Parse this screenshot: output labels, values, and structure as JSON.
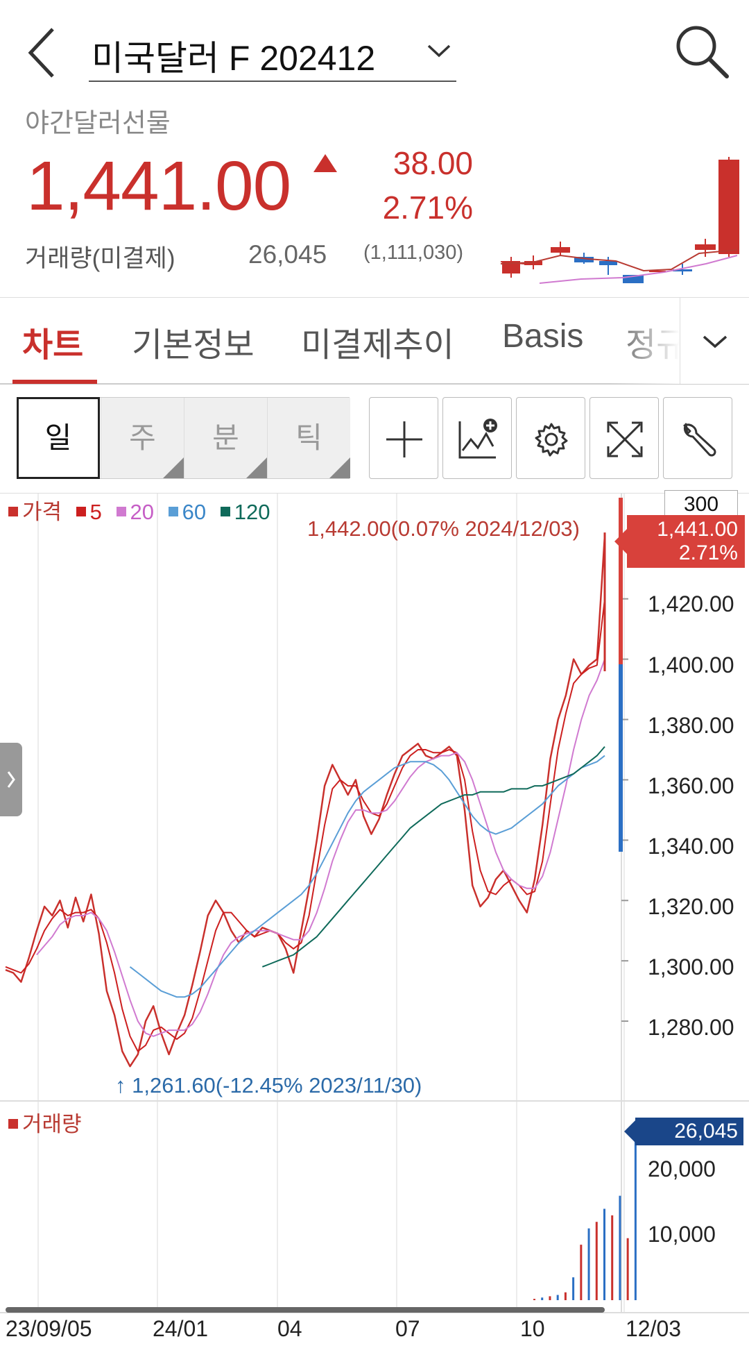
{
  "header": {
    "title": "미국달러 F 202412"
  },
  "quote": {
    "market_name": "야간달러선물",
    "price": "1,441.00",
    "change": "38.00",
    "change_pct": "2.71%",
    "volume_label": "거래량(미결제)",
    "volume": "26,045",
    "open_interest": "(1,111,030)"
  },
  "tabs": [
    {
      "label": "차트",
      "active": true
    },
    {
      "label": "기본정보",
      "active": false
    },
    {
      "label": "미결제추이",
      "active": false
    },
    {
      "label": "Basis",
      "active": false
    },
    {
      "label": "정규",
      "active": false
    }
  ],
  "toolbar": {
    "periods": [
      "일",
      "주",
      "분",
      "틱"
    ],
    "active_period": "일",
    "tools": [
      "crosshair-icon",
      "add-indicator-icon",
      "gear-icon",
      "expand-icon",
      "wrench-icon"
    ]
  },
  "chart": {
    "legend": {
      "price": "가격",
      "ma5": "5",
      "ma20": "20",
      "ma60": "60",
      "ma120": "120"
    },
    "count": "300",
    "high_label": "1,442.00(0.07% 2024/12/03)",
    "low_label": "1,261.60(-12.45% 2023/11/30)",
    "price_tag_value": "1,441.00",
    "price_tag_pct": "2.71%",
    "volume_legend": "거래량",
    "volume_tag": "26,045",
    "colors": {
      "up": "#c9302c",
      "down": "#2b6fc4",
      "ma5": "#cc1f1f",
      "ma20": "#d07ad0",
      "ma60": "#5a9ed6",
      "ma120": "#0f6a5a"
    }
  },
  "chart_data": {
    "type": "line",
    "title": "",
    "y_ticks": [
      "1,420.00",
      "1,400.00",
      "1,380.00",
      "1,360.00",
      "1,340.00",
      "1,320.00",
      "1,300.00",
      "1,280.00"
    ],
    "ylim": [
      1257,
      1448
    ],
    "x_ticks": [
      "23/09/05",
      "24/01",
      "04",
      "07",
      "10",
      "12/03"
    ],
    "volume_ticks": [
      "20,000",
      "10,000"
    ],
    "series": [
      {
        "name": "가격",
        "values": [
          1297,
          1296,
          1293,
          1301,
          1310,
          1318,
          1315,
          1320,
          1311,
          1321,
          1313,
          1322,
          1309,
          1290,
          1282,
          1270,
          1265,
          1269,
          1280,
          1285,
          1276,
          1269,
          1276,
          1282,
          1292,
          1303,
          1315,
          1320,
          1316,
          1310,
          1306,
          1310,
          1308,
          1311,
          1310,
          1309,
          1304,
          1296,
          1310,
          1324,
          1340,
          1358,
          1365,
          1360,
          1355,
          1360,
          1348,
          1342,
          1347,
          1355,
          1362,
          1368,
          1370,
          1372,
          1368,
          1367,
          1369,
          1371,
          1368,
          1350,
          1325,
          1318,
          1321,
          1327,
          1330,
          1325,
          1320,
          1316,
          1327,
          1345,
          1367,
          1380,
          1388,
          1400,
          1395,
          1398,
          1400,
          1441
        ]
      },
      {
        "name": "5",
        "values": [
          1298,
          1297,
          1296,
          1299,
          1304,
          1310,
          1314,
          1317,
          1315,
          1316,
          1316,
          1317,
          1314,
          1306,
          1296,
          1284,
          1275,
          1270,
          1272,
          1277,
          1278,
          1276,
          1274,
          1276,
          1281,
          1290,
          1300,
          1310,
          1316,
          1316,
          1313,
          1310,
          1308,
          1309,
          1310,
          1309,
          1306,
          1304,
          1306,
          1315,
          1330,
          1345,
          1357,
          1360,
          1358,
          1358,
          1353,
          1349,
          1348,
          1352,
          1358,
          1364,
          1368,
          1370,
          1370,
          1369,
          1369,
          1370,
          1369,
          1360,
          1343,
          1330,
          1323,
          1322,
          1325,
          1327,
          1325,
          1322,
          1323,
          1333,
          1352,
          1370,
          1382,
          1392,
          1395,
          1397,
          1398,
          1420
        ]
      },
      {
        "name": "20",
        "values": [
          null,
          null,
          null,
          null,
          1302,
          1305,
          1308,
          1312,
          1314,
          1315,
          1315,
          1316,
          1314,
          1310,
          1303,
          1295,
          1287,
          1280,
          1276,
          1275,
          1276,
          1277,
          1277,
          1277,
          1279,
          1283,
          1289,
          1296,
          1302,
          1306,
          1308,
          1309,
          1310,
          1310,
          1310,
          1309,
          1308,
          1307,
          1307,
          1310,
          1316,
          1324,
          1333,
          1340,
          1346,
          1350,
          1350,
          1349,
          1349,
          1350,
          1353,
          1357,
          1361,
          1364,
          1366,
          1367,
          1368,
          1368,
          1369,
          1366,
          1360,
          1352,
          1344,
          1336,
          1330,
          1327,
          1325,
          1324,
          1324,
          1328,
          1336,
          1347,
          1358,
          1370,
          1380,
          1388,
          1393,
          1400
        ]
      },
      {
        "name": "60",
        "values": [
          null,
          null,
          null,
          null,
          null,
          null,
          null,
          null,
          null,
          null,
          null,
          null,
          null,
          null,
          null,
          null,
          1298,
          1296,
          1294,
          1292,
          1290,
          1289,
          1288,
          1288,
          1289,
          1291,
          1294,
          1297,
          1300,
          1303,
          1306,
          1308,
          1310,
          1312,
          1314,
          1316,
          1318,
          1320,
          1322,
          1325,
          1329,
          1334,
          1339,
          1344,
          1349,
          1353,
          1356,
          1358,
          1360,
          1362,
          1364,
          1365,
          1366,
          1366,
          1366,
          1365,
          1363,
          1360,
          1356,
          1352,
          1348,
          1345,
          1343,
          1342,
          1343,
          1344,
          1346,
          1348,
          1350,
          1352,
          1355,
          1358,
          1360,
          1362,
          1364,
          1365,
          1366,
          1368
        ]
      },
      {
        "name": "120",
        "values": [
          null,
          null,
          null,
          null,
          null,
          null,
          null,
          null,
          null,
          null,
          null,
          null,
          null,
          null,
          null,
          null,
          null,
          null,
          null,
          null,
          null,
          null,
          null,
          null,
          null,
          null,
          null,
          null,
          null,
          null,
          null,
          null,
          null,
          1298,
          1299,
          1300,
          1301,
          1302,
          1304,
          1306,
          1308,
          1311,
          1314,
          1317,
          1320,
          1323,
          1326,
          1329,
          1332,
          1335,
          1338,
          1341,
          1344,
          1346,
          1348,
          1350,
          1352,
          1353,
          1354,
          1355,
          1355,
          1356,
          1356,
          1356,
          1356,
          1357,
          1357,
          1357,
          1358,
          1358,
          1359,
          1360,
          1361,
          1362,
          1364,
          1366,
          1368,
          1371
        ]
      }
    ],
    "volume_ylim": [
      0,
      30000
    ],
    "volume_values": [
      0,
      0,
      0,
      0,
      0,
      0,
      0,
      0,
      0,
      0,
      0,
      0,
      0,
      0,
      0,
      0,
      0,
      0,
      0,
      0,
      0,
      0,
      0,
      0,
      0,
      0,
      0,
      0,
      0,
      0,
      0,
      0,
      0,
      0,
      0,
      0,
      0,
      0,
      0,
      0,
      0,
      0,
      0,
      0,
      0,
      0,
      0,
      0,
      0,
      0,
      0,
      0,
      0,
      0,
      0,
      0,
      0,
      0,
      0,
      0,
      0,
      0,
      0,
      0,
      0,
      0,
      0,
      0,
      200,
      400,
      600,
      800,
      1200,
      3500,
      8500,
      11000,
      12000,
      14000,
      13000,
      16000,
      9500,
      26045
    ]
  }
}
